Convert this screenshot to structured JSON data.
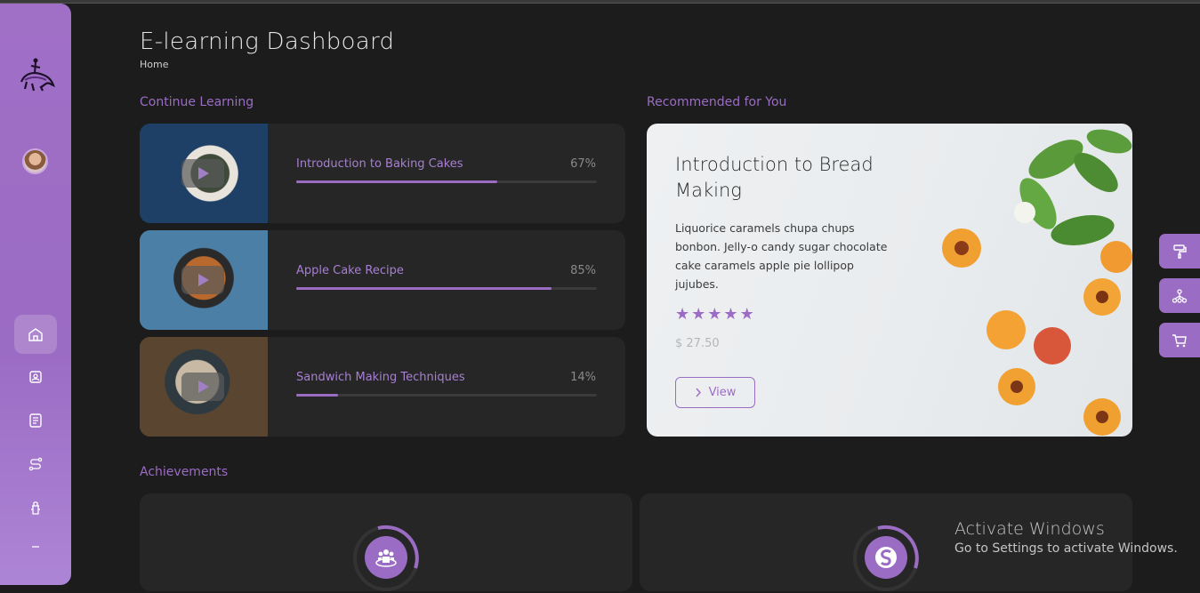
{
  "header": {
    "title": "E-learning Dashboard",
    "breadcrumb": "Home"
  },
  "sections": {
    "continue_learning": "Continue Learning",
    "recommended": "Recommended for You",
    "achievements": "Achievements"
  },
  "courses": [
    {
      "name": "Introduction to Baking Cakes",
      "progress_label": "67%",
      "progress": 67
    },
    {
      "name": "Apple Cake Recipe",
      "progress_label": "85%",
      "progress": 85
    },
    {
      "name": "Sandwich Making Techniques",
      "progress_label": "14%",
      "progress": 14
    }
  ],
  "recommended": {
    "title": "Introduction to Bread Making",
    "description": "Liquorice caramels chupa chups bonbon. Jelly-o candy sugar chocolate cake caramels apple pie lollipop jujubes.",
    "rating": 5,
    "price": "$ 27.50",
    "view_label": "View"
  },
  "sidebar": {
    "nav": [
      "home-icon",
      "user-card-icon",
      "checklist-icon",
      "route-icon",
      "fire-hydrant-icon",
      "more-icon"
    ],
    "active": "home-icon"
  },
  "side_buttons": [
    "paint-roller-icon",
    "sitemap-icon",
    "cart-icon"
  ],
  "watermark": {
    "line1": "Activate Windows",
    "line2": "Go to Settings to activate Windows."
  },
  "colors": {
    "accent": "#9b6cc4",
    "background": "#1c1c1c",
    "card": "#262626"
  }
}
